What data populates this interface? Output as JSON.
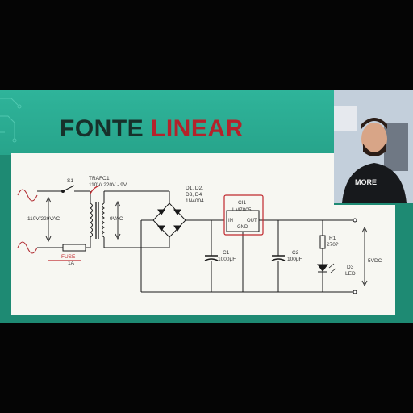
{
  "slide": {
    "title_part1": "FONTE",
    "title_part2": "LINEAR",
    "title_color_dark": "#17312b",
    "title_color_accent": "#b4232b",
    "background_color": "#1e8a73"
  },
  "schematic": {
    "switch_label": "S1",
    "transformer_name": "TRAFO1",
    "transformer_spec": "110V/ 220V - 9V",
    "input_voltage": "110V/220VAC",
    "secondary_voltage": "9VAC",
    "fuse_name": "FUSE",
    "fuse_rating": "1A",
    "diodes_line1": "D1, D2,",
    "diodes_line2": "D3, D4",
    "diodes_part": "1N4004",
    "regulator_name": "CI1",
    "regulator_part": "LM7805",
    "regulator_in": "IN",
    "regulator_out": "OUT",
    "regulator_gnd": "GND",
    "c1_name": "C1",
    "c1_value": "1000μF",
    "c2_name": "C2",
    "c2_value": "100μF",
    "r1_name": "R1",
    "r1_value": "270?",
    "d3_name": "D3",
    "d3_type": "LED",
    "output_voltage": "5VDC"
  },
  "webcam": {
    "shirt_text": "MORE"
  }
}
